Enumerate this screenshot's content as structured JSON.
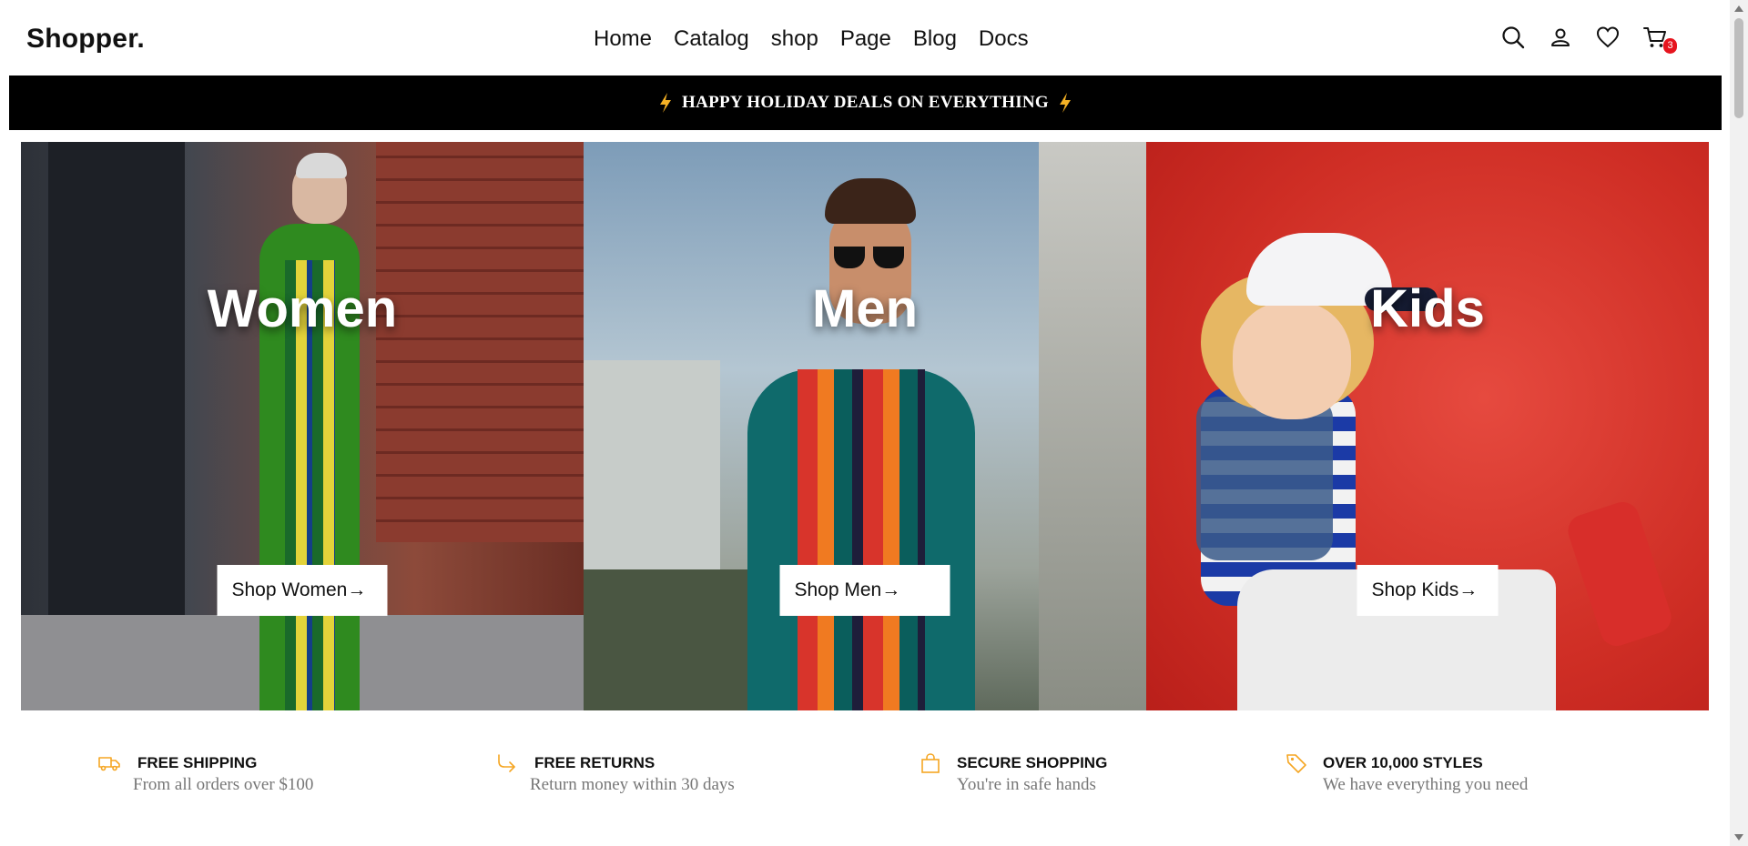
{
  "brand": "Shopper.",
  "nav": [
    "Home",
    "Catalog",
    "shop",
    "Page",
    "Blog",
    "Docs"
  ],
  "header_icons": [
    "search-icon",
    "user-icon",
    "heart-icon",
    "cart-icon"
  ],
  "cart_count": "3",
  "promo": {
    "text": "HAPPY HOLIDAY DEALS ON EVERYTHING",
    "icon": "bolt-icon",
    "icon_color": "#f5b225"
  },
  "categories": [
    {
      "title": "Women",
      "button": "Shop Women"
    },
    {
      "title": "Men",
      "button": "Shop Men"
    },
    {
      "title": "Kids",
      "button": "Shop Kids"
    }
  ],
  "features": [
    {
      "icon": "truck-icon",
      "title": "FREE SHIPPING",
      "subtitle": "From all orders over $100"
    },
    {
      "icon": "return-arrow-icon",
      "title": "FREE RETURNS",
      "subtitle": "Return money within 30 days"
    },
    {
      "icon": "bag-icon",
      "title": "SECURE SHOPPING",
      "subtitle": "You're in safe hands"
    },
    {
      "icon": "tag-icon",
      "title": "OVER 10,000 STYLES",
      "subtitle": "We have everything you need"
    }
  ],
  "colors": {
    "accent": "#f5a623",
    "badge": "#e6141e",
    "promo_bg": "#000000"
  }
}
